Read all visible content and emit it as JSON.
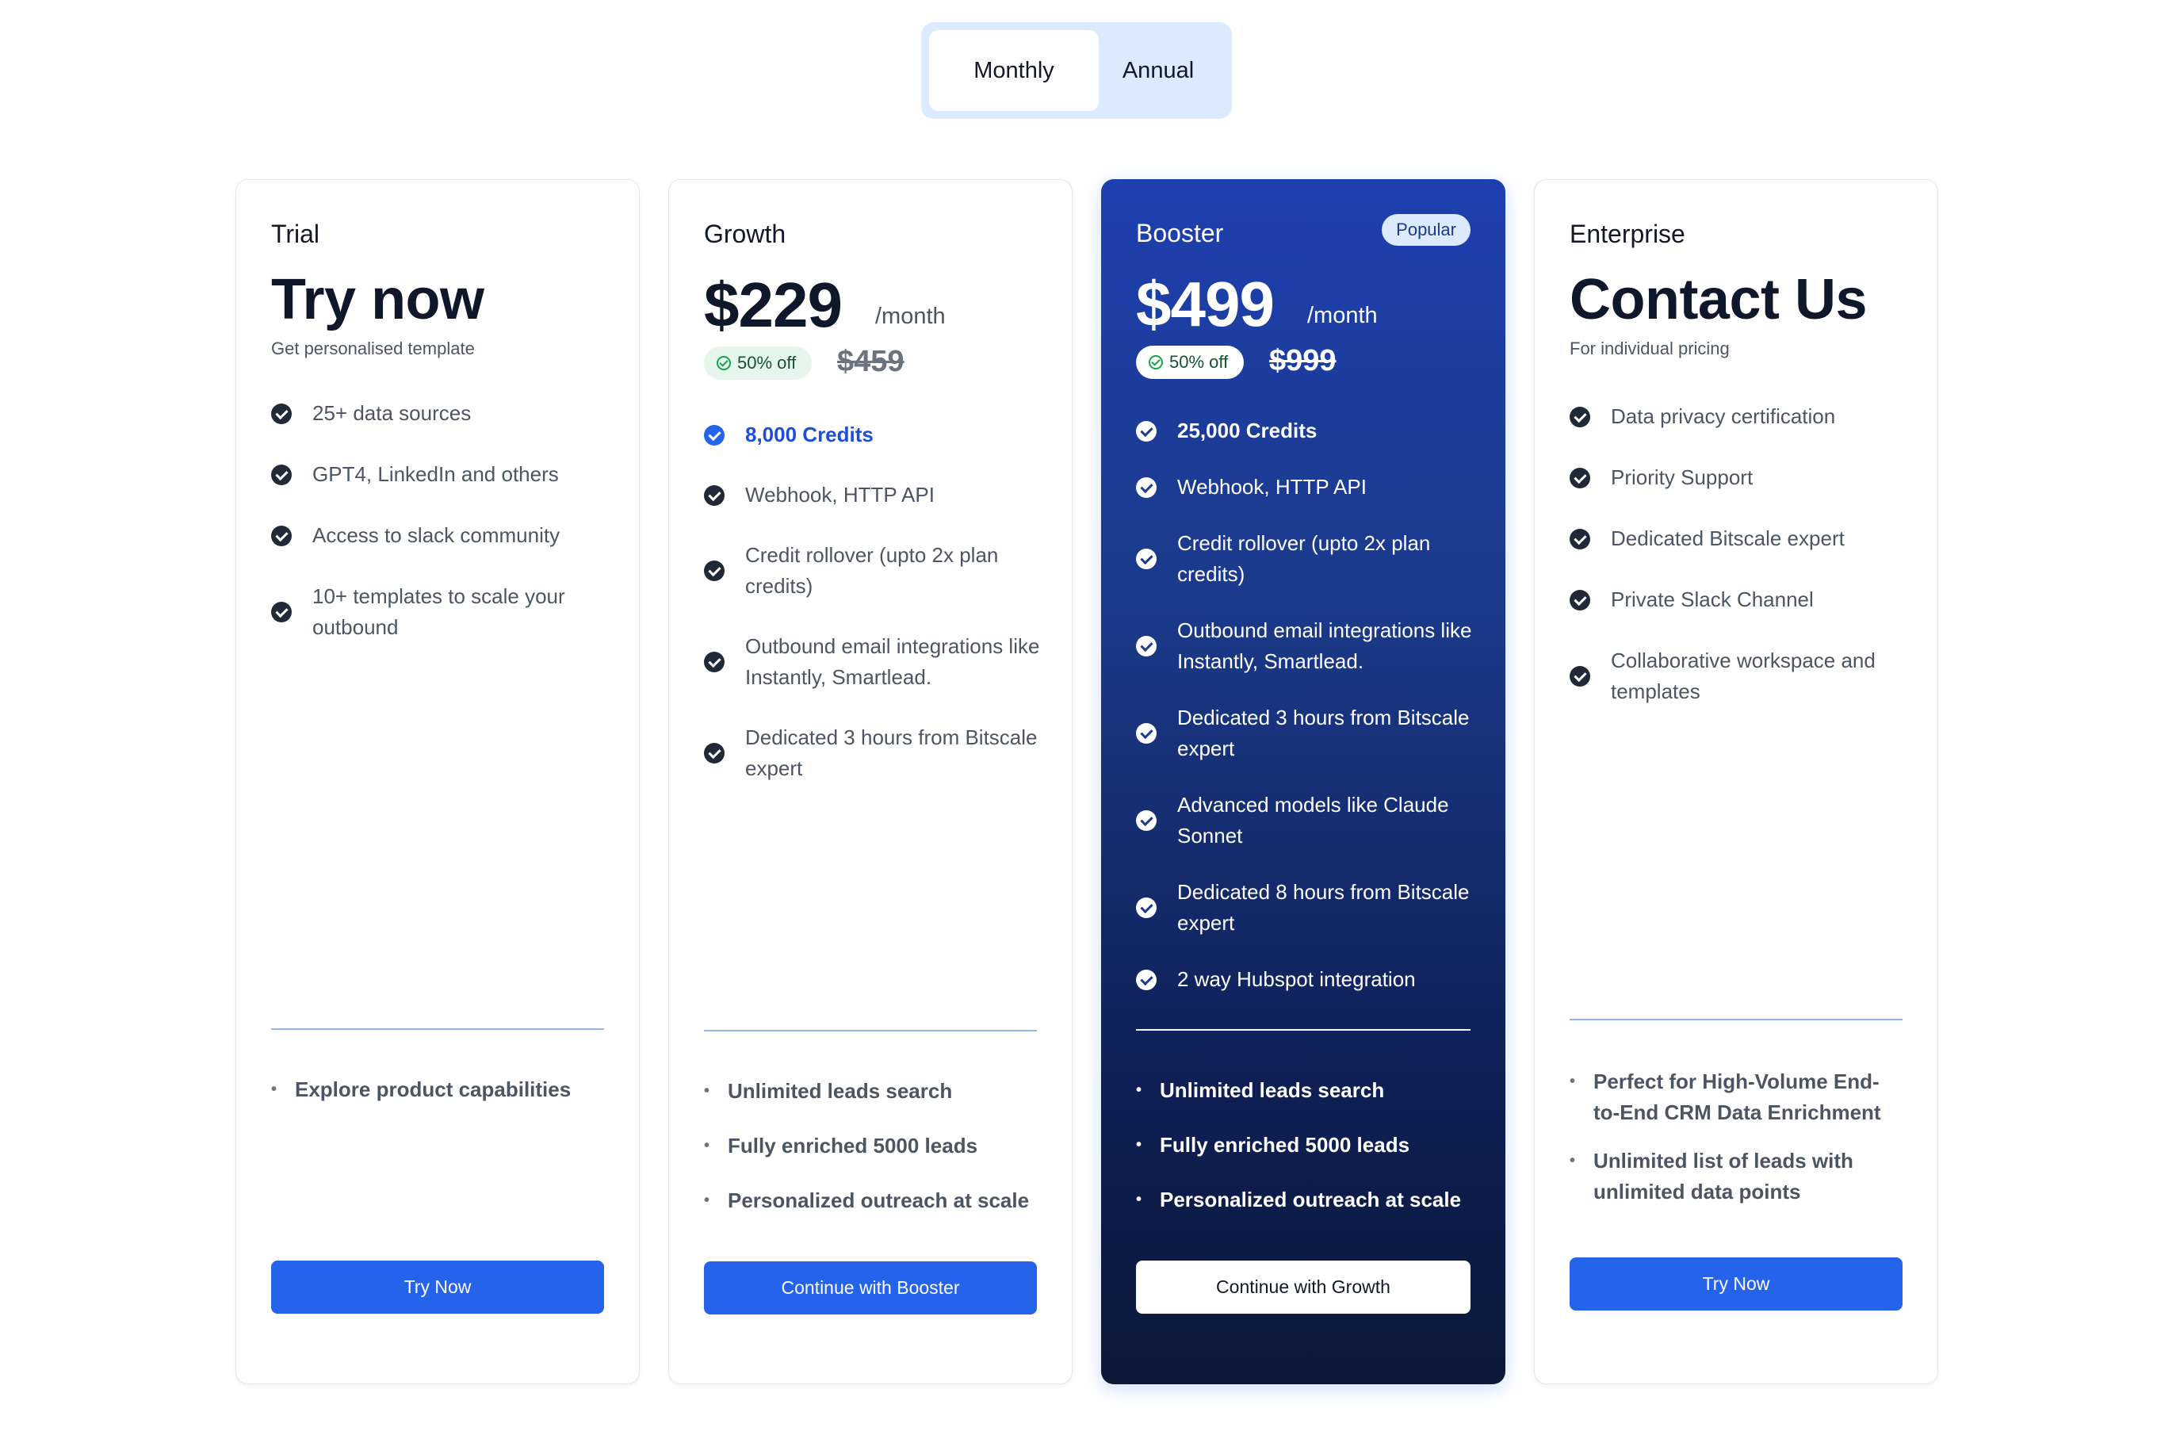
{
  "toggle": {
    "monthly": "Monthly",
    "annual": "Annual",
    "selected": "Monthly"
  },
  "plans": [
    {
      "name": "Trial",
      "headline": "Try now",
      "subtitle": "Get personalised template",
      "features": [
        "25+ data sources",
        "GPT4, LinkedIn and others",
        "Access to slack community",
        "10+ templates to scale your outbound"
      ],
      "bullets": [
        "Explore product capabilities"
      ],
      "cta": "Try Now"
    },
    {
      "name": "Growth",
      "price": "$229",
      "period": "/month",
      "discount": "50% off",
      "old_price": "$459",
      "features": [
        "8,000 Credits",
        "Webhook, HTTP API",
        "Credit rollover (upto 2x plan credits)",
        "Outbound email integrations like Instantly, Smartlead.",
        "Dedicated 3 hours from Bitscale expert"
      ],
      "bullets": [
        "Unlimited leads search",
        "Fully enriched 5000 leads",
        "Personalized outreach at scale"
      ],
      "cta": "Continue with Booster"
    },
    {
      "name": "Booster",
      "badge": "Popular",
      "price": "$499",
      "period": "/month",
      "discount": "50% off",
      "old_price": "$999",
      "features": [
        "25,000 Credits",
        "Webhook, HTTP API",
        "Credit rollover (upto 2x plan credits)",
        "Outbound email integrations like Instantly, Smartlead.",
        "Dedicated 3 hours from Bitscale expert",
        "Advanced models like Claude Sonnet",
        "Dedicated 8 hours from Bitscale expert",
        "2 way Hubspot integration"
      ],
      "bullets": [
        "Unlimited leads search",
        "Fully enriched 5000 leads",
        "Personalized outreach at scale"
      ],
      "cta": "Continue with Growth"
    },
    {
      "name": "Enterprise",
      "headline": "Contact Us",
      "subtitle": "For individual pricing",
      "features": [
        "Data privacy certification",
        "Priority Support",
        "Dedicated Bitscale expert",
        "Private Slack Channel",
        "Collaborative workspace and templates"
      ],
      "bullets": [
        "Perfect for High-Volume End-to-End CRM Data Enrichment",
        "Unlimited list of leads with unlimited data points"
      ],
      "cta": "Try Now"
    }
  ],
  "colors": {
    "accent": "#2563eb",
    "booster_top": "#1e40af",
    "booster_bottom": "#0b1838",
    "discount_bg": "#e7f6ec"
  }
}
